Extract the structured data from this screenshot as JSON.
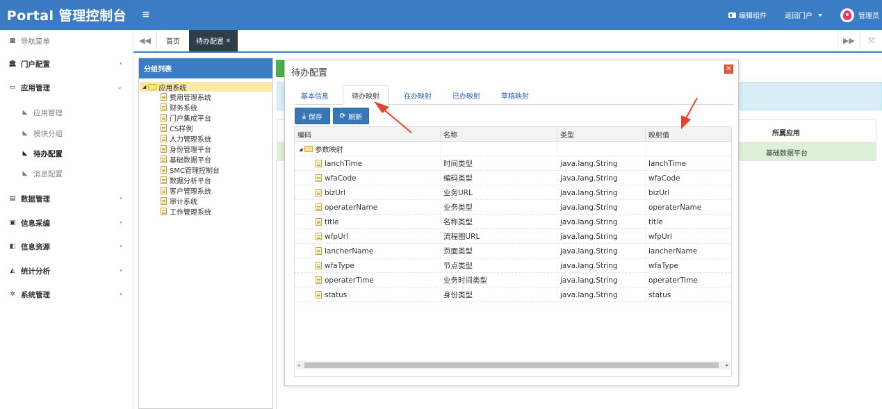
{
  "app": {
    "brand": "Portal 管理控制台",
    "menu_glyph": "≡"
  },
  "topnav": {
    "edit_widget": "编辑组件",
    "back_portal": "返回门户",
    "user": "管理员"
  },
  "sidebar": {
    "header": "导航菜单",
    "items": [
      {
        "label": "门户配置",
        "icon": "bank-icon",
        "glyph": "🏛",
        "arrow": "‹"
      },
      {
        "label": "应用管理",
        "icon": "monitor-icon",
        "glyph": "▭",
        "arrow": "⌄"
      },
      {
        "label": "应用管理",
        "icon": "tag-icon",
        "glyph": "◣"
      },
      {
        "label": "模块分组",
        "icon": "tag-icon",
        "glyph": "◣"
      },
      {
        "label": "待办配置",
        "icon": "tag-icon",
        "glyph": "◣"
      },
      {
        "label": "消息配置",
        "icon": "tag-icon",
        "glyph": "◣"
      },
      {
        "label": "数据管理",
        "icon": "list-icon",
        "glyph": "▤",
        "arrow": "‹"
      },
      {
        "label": "信息采编",
        "icon": "id-card-icon",
        "glyph": "▣",
        "arrow": "‹"
      },
      {
        "label": "信息资源",
        "icon": "book-icon",
        "glyph": "◧",
        "arrow": "‹"
      },
      {
        "label": "统计分析",
        "icon": "area-chart-icon",
        "glyph": "◭",
        "arrow": "‹"
      },
      {
        "label": "系统管理",
        "icon": "cogs-icon",
        "glyph": "✲",
        "arrow": "‹"
      }
    ]
  },
  "tabs": {
    "home": "首页",
    "active": "待办配置",
    "close_glyph": "✖",
    "prev_glyph": "◀◀",
    "next_glyph": "▶▶",
    "fullscreen_glyph": "⤧"
  },
  "group_panel": {
    "title": "分组列表",
    "root": "应用系统",
    "children": [
      "费用管理系统",
      "财务系统",
      "门户集成平台",
      "CS样例",
      "人力管理系统",
      "身份管理平台",
      "基础数据平台",
      "SMC管理控制台",
      "数据分析平台",
      "客户管理系统",
      "审计系统",
      "工作管理系统"
    ]
  },
  "background": {
    "th_app": "所属应用",
    "cell_app": "基础数据平台"
  },
  "dialog": {
    "title": "待办配置",
    "close_glyph": "✕",
    "tabs": [
      "基本信息",
      "待办映射",
      "在办映射",
      "已办映射",
      "草稿映射"
    ],
    "save_label": "保存",
    "refresh_label": "刷新",
    "save_glyph": "⤓",
    "refresh_glyph": "⟳",
    "columns": [
      "编码",
      "名称",
      "类型",
      "映射值"
    ],
    "group_label": "参数映射",
    "rows": [
      {
        "code": "lanchTime",
        "name": "时间类型",
        "type": "java.lang.String",
        "value": "lanchTime"
      },
      {
        "code": "wfaCode",
        "name": "编码类型",
        "type": "java.lang.String",
        "value": "wfaCode"
      },
      {
        "code": "bizUrl",
        "name": "业务URL",
        "type": "java.lang.String",
        "value": "bizUrl"
      },
      {
        "code": "operaterName",
        "name": "业务类型",
        "type": "java.lang.String",
        "value": "operaterName"
      },
      {
        "code": "title",
        "name": "名称类型",
        "type": "java.lang.String",
        "value": "title"
      },
      {
        "code": "wfpUrl",
        "name": "流程图URL",
        "type": "java.lang.String",
        "value": "wfpUrl"
      },
      {
        "code": "lancherName",
        "name": "页面类型",
        "type": "java.lang.String",
        "value": "lancherName"
      },
      {
        "code": "wfaType",
        "name": "节点类型",
        "type": "java.lang.String",
        "value": "wfaType"
      },
      {
        "code": "operaterTime",
        "name": "业务时间类型",
        "type": "java.lang.String",
        "value": "operaterTime"
      },
      {
        "code": "status",
        "name": "身份类型",
        "type": "java.lang.String",
        "value": "status"
      }
    ]
  },
  "colors": {
    "primary": "#3b7dc4",
    "tab_active": "#2f3c49",
    "annotation_arrow": "#e8412c"
  }
}
